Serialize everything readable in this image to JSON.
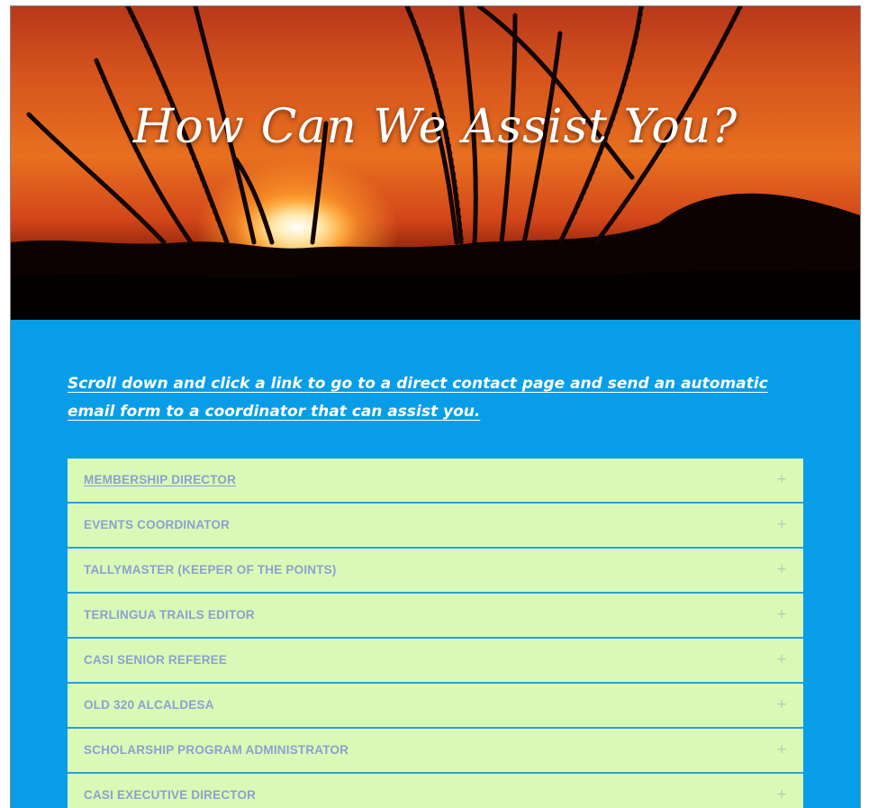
{
  "hero": {
    "title": "How Can We Assist You?"
  },
  "intro": {
    "text": " Scroll down and click a link to go to a direct contact page and send an automatic email form to a coordinator that can assist you."
  },
  "accordion": {
    "expand_icon": "+",
    "items": [
      {
        "label": "MEMBERSHIP DIRECTOR"
      },
      {
        "label": "EVENTS COORDINATOR"
      },
      {
        "label": "TALLYMASTER (KEEPER OF THE POINTS)"
      },
      {
        "label": "TERLINGUA TRAILS EDITOR"
      },
      {
        "label": "CASI SENIOR REFEREE"
      },
      {
        "label": "OLD 320 ALCALDESA"
      },
      {
        "label": "SCHOLARSHIP PROGRAM ADMINISTRATOR"
      },
      {
        "label": "CASI EXECUTIVE DIRECTOR"
      }
    ]
  }
}
